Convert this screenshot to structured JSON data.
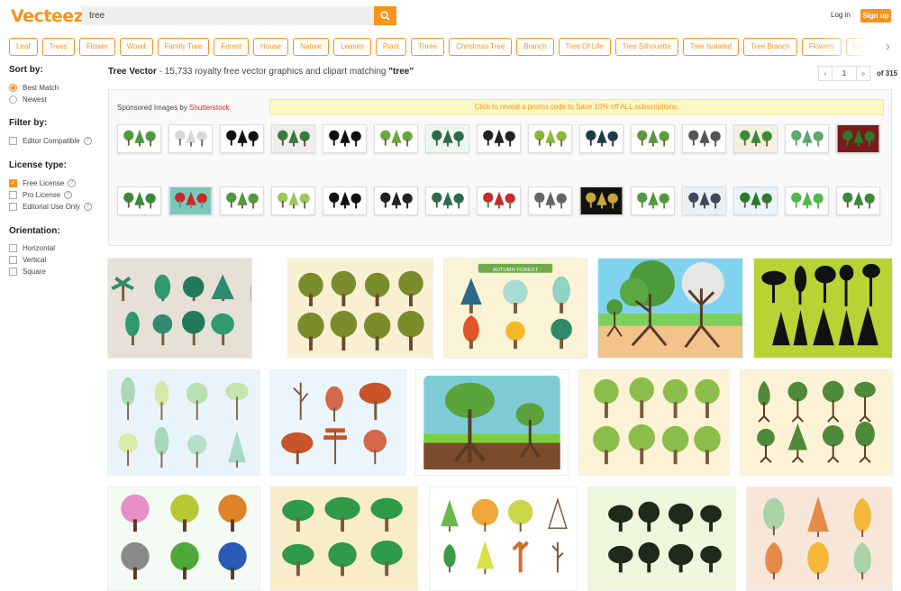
{
  "header": {
    "logo": "Vecteezy",
    "search_value": "tree",
    "login_label": "Log in",
    "signup_label": "Sign up",
    "accent": "#f7941d"
  },
  "tags": [
    "Leaf",
    "Trees",
    "Flower",
    "Wood",
    "Family Tree",
    "Forest",
    "House",
    "Nature",
    "Leaves",
    "Plant",
    "Three",
    "Christmas Tree",
    "Branch",
    "Tree Of Life",
    "Tree Silhouette",
    "Tree Isolated",
    "Tree Branch",
    "Flowers",
    "Christmas Tree"
  ],
  "sidebar": {
    "sort_heading": "Sort by:",
    "sort_options": [
      {
        "label": "Best Match",
        "selected": true
      },
      {
        "label": "Newest",
        "selected": false
      }
    ],
    "filter_heading": "Filter by:",
    "filter_options": [
      {
        "label": "Editor Compatible",
        "checked": false,
        "help": true
      }
    ],
    "license_heading": "License type:",
    "license_options": [
      {
        "label": "Free License",
        "checked": true,
        "help": true
      },
      {
        "label": "Pro License",
        "checked": false,
        "help": true
      },
      {
        "label": "Editorial Use Only",
        "checked": false,
        "help": true
      }
    ],
    "orientation_heading": "Orientation:",
    "orientation_options": [
      {
        "label": "Horizontal",
        "checked": false
      },
      {
        "label": "Vertical",
        "checked": false
      },
      {
        "label": "Square",
        "checked": false
      }
    ]
  },
  "results": {
    "title": "Tree Vector",
    "summary": " - 15,733 royalty free vector graphics and clipart matching ",
    "query": "\"tree\""
  },
  "pagination": {
    "prev": "‹",
    "current": "1",
    "next": "»",
    "of_label": "of 315"
  },
  "sponsored": {
    "label_prefix": "Sponsored Images by ",
    "brand": "Shutterstock",
    "promo": "Click to reveal a promo code to Save 10% off ALL subscriptions.",
    "row1_count": 15,
    "row2_count": 15
  },
  "gallery_banner": "AUTUMN FOREST",
  "colors": {
    "tree_green": "#6f9a2f",
    "dark_green": "#2e5d3a",
    "trunk": "#7b5a3c",
    "silhouette": "#111111"
  }
}
